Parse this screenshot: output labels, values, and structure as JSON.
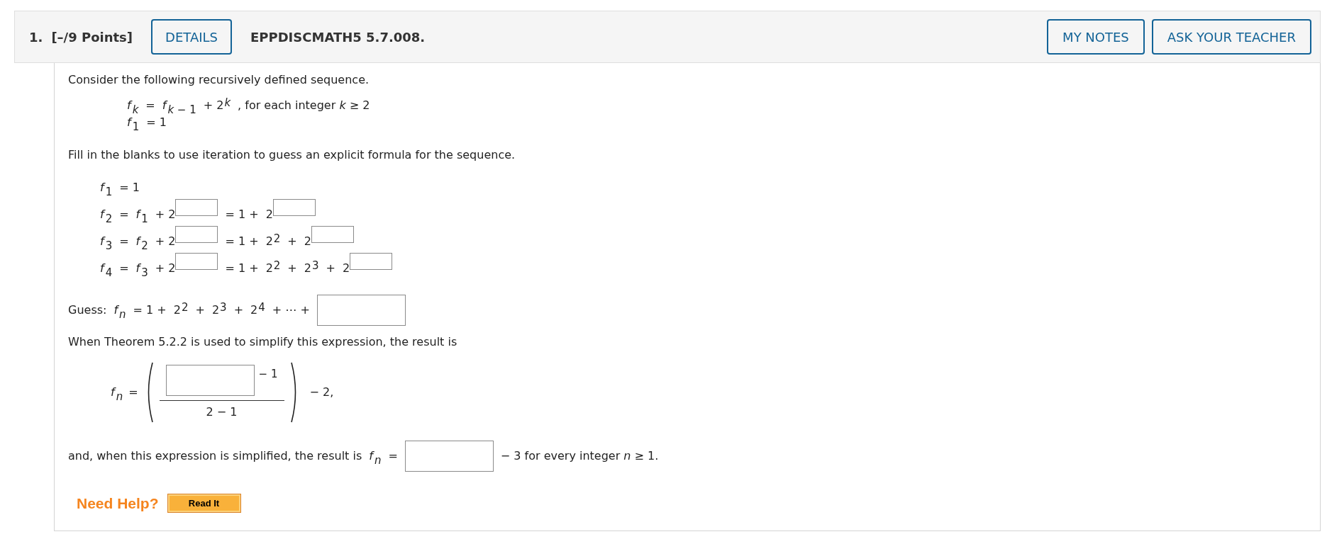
{
  "header": {
    "number": "1.",
    "points": "[–/9 Points]",
    "details_button": "DETAILS",
    "code": "EPPDISCMATH5 5.7.008.",
    "buttons": [
      "MY NOTES",
      "ASK YOUR TEACHER"
    ]
  },
  "blocks": [
    {
      "kind": "paragraph",
      "text": "Consider the following recursively defined sequence."
    },
    {
      "kind": "definition",
      "lines": [
        [
          {
            "kind": "var",
            "text": "f",
            "sub": "*k*"
          },
          {
            "kind": "text",
            "text": "="
          },
          {
            "kind": "var",
            "text": "f",
            "sub": "*k* − 1"
          },
          {
            "kind": "power",
            "base": "+ 2",
            "exp": "*k*"
          },
          {
            "kind": "text",
            "text": ", for each integer *k* ≥ 2"
          }
        ],
        [
          {
            "kind": "var",
            "text": "f",
            "sub": "1"
          },
          {
            "kind": "text",
            "text": "= 1"
          }
        ]
      ]
    },
    {
      "kind": "paragraph",
      "text": "Fill in the blanks to use iteration to guess an explicit formula for the sequence."
    },
    {
      "kind": "iteration",
      "lines": [
        [
          {
            "kind": "var",
            "text": "f",
            "sub": "1"
          },
          {
            "kind": "text",
            "text": "= 1"
          }
        ],
        [
          {
            "kind": "var",
            "text": "f",
            "sub": "2"
          },
          {
            "kind": "text",
            "text": "="
          },
          {
            "kind": "var",
            "text": "f",
            "sub": "1"
          },
          {
            "kind": "power_blank",
            "base": "+ 2"
          },
          {
            "kind": "text",
            "text": "= 1 +"
          },
          {
            "kind": "power_blank",
            "base": "2"
          }
        ],
        [
          {
            "kind": "var",
            "text": "f",
            "sub": "3"
          },
          {
            "kind": "text",
            "text": "="
          },
          {
            "kind": "var",
            "text": "f",
            "sub": "2"
          },
          {
            "kind": "power_blank",
            "base": "+ 2"
          },
          {
            "kind": "text",
            "text": "= 1 +"
          },
          {
            "kind": "power",
            "base": "2",
            "exp": "2"
          },
          {
            "kind": "text",
            "text": "+"
          },
          {
            "kind": "power_blank",
            "base": "2"
          }
        ],
        [
          {
            "kind": "var",
            "text": "f",
            "sub": "4"
          },
          {
            "kind": "text",
            "text": "="
          },
          {
            "kind": "var",
            "text": "f",
            "sub": "3"
          },
          {
            "kind": "power_blank",
            "base": "+ 2"
          },
          {
            "kind": "text",
            "text": "= 1 +"
          },
          {
            "kind": "power",
            "base": "2",
            "exp": "2"
          },
          {
            "kind": "text",
            "text": "+"
          },
          {
            "kind": "power",
            "base": "2",
            "exp": "3"
          },
          {
            "kind": "text",
            "text": "+"
          },
          {
            "kind": "power_blank",
            "base": "2"
          }
        ]
      ]
    },
    {
      "kind": "guess",
      "lines": [
        [
          {
            "kind": "text",
            "text": "Guess:"
          },
          {
            "kind": "var",
            "text": "f",
            "sub": "*n*"
          },
          {
            "kind": "text",
            "text": "= 1 +"
          },
          {
            "kind": "power",
            "base": "2",
            "exp": "2"
          },
          {
            "kind": "text",
            "text": "+"
          },
          {
            "kind": "power",
            "base": "2",
            "exp": "3"
          },
          {
            "kind": "text",
            "text": "+"
          },
          {
            "kind": "power",
            "base": "2",
            "exp": "4"
          },
          {
            "kind": "text",
            "text": "+ ⋯ +"
          },
          {
            "kind": "blank"
          }
        ]
      ]
    },
    {
      "kind": "paragraph",
      "text": "When Theorem 5.2.2 is used to simplify this expression, the result is"
    },
    {
      "kind": "fraction",
      "lhs": {
        "text": "f",
        "sub": "*n*"
      },
      "equals": "=",
      "numerator_exp": "− 1",
      "denominator": "2 − 1",
      "after": "− 2,"
    },
    {
      "kind": "conclusion",
      "lines": [
        [
          {
            "kind": "text",
            "text": "and, when this expression is simplified, the result is"
          },
          {
            "kind": "var",
            "text": "f",
            "sub": "*n*"
          },
          {
            "kind": "text",
            "text": "="
          },
          {
            "kind": "blank"
          },
          {
            "kind": "text",
            "text": "− 3 for every integer *n* ≥ 1."
          }
        ]
      ]
    }
  ],
  "help": {
    "label": "Need Help?",
    "buttons": [
      "Read It"
    ]
  }
}
